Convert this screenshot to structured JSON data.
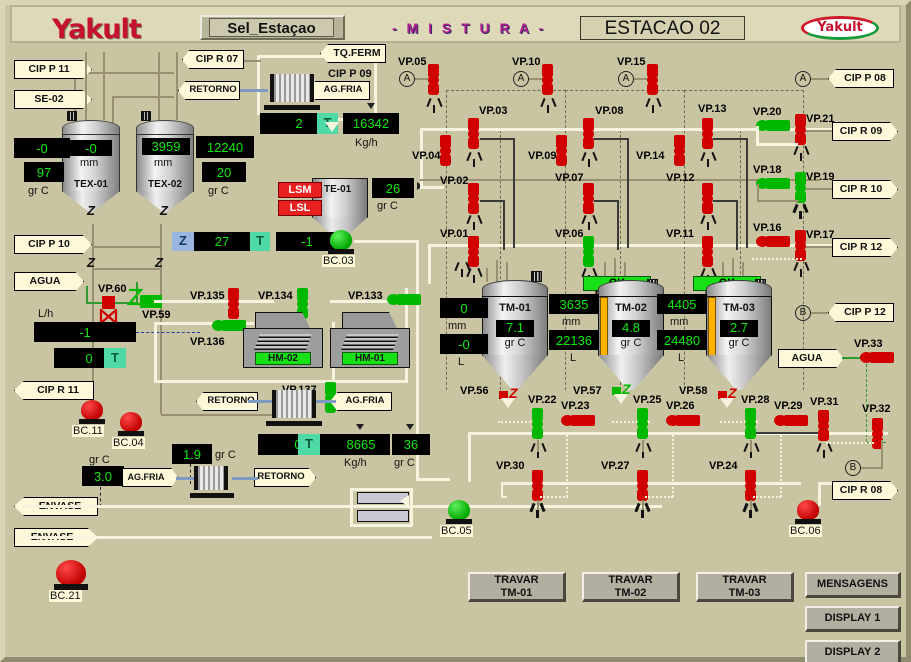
{
  "header": {
    "logo": "Yakult",
    "sel_button": "Sel_Estaçao",
    "mistura": "- M I S T U R A -",
    "station": "ESTACAO 02",
    "brand_badge": "Yakult"
  },
  "left_tags": {
    "cip_p11": "CIP P 11",
    "se02": "SE-02",
    "cip_p10": "CIP P 10",
    "agua": "AGUA",
    "cip_r11": "CIP R 11",
    "envase1": "ENVASE",
    "envase2": "ENVASE"
  },
  "top_tags": {
    "cip_r07": "CIP R 07",
    "tq_ferm": "TQ.FERM",
    "cip_p09": "CIP P 09",
    "retorno_top": "RETORNO",
    "ag_fria_top": "AG.FRIA"
  },
  "right_tags": {
    "cip_p08": "CIP P 08",
    "cip_r09": "CIP R 09",
    "cip_r10": "CIP R 10",
    "cip_r12": "CIP R 12",
    "cip_p12": "CIP P 12",
    "agua_right": "AGUA",
    "cip_r08": "CIP R 08"
  },
  "bottom_tags": {
    "retorno_mid": "RETORNO",
    "ag_fria_mid": "AG.FRIA",
    "ag_fria_low": "AG.FRIA",
    "retorno_low": "RETORNO"
  },
  "tanks": {
    "tex01": {
      "name": "TEX-01",
      "level": "-0",
      "unit": "mm",
      "vol": "-0",
      "temp": "97",
      "temp_unit": "gr C"
    },
    "tex02": {
      "name": "TEX-02",
      "level": "3959",
      "unit": "mm",
      "vol": "12240",
      "temp": "20",
      "temp_unit": "gr C"
    },
    "te01": {
      "name": "TE-01",
      "temp": "26",
      "temp_unit": "gr C",
      "alarm_hi": "LSM",
      "alarm_lo": "LSL"
    },
    "tm01": {
      "name": "TM-01",
      "level": "0",
      "unit": "mm",
      "volume": "-0",
      "vol_unit": "L",
      "temp": "7.1",
      "temp_unit": "gr C",
      "status": "",
      "level_pct": 0
    },
    "tm02": {
      "name": "TM-02",
      "level": "3635",
      "unit": "mm",
      "volume": "22136",
      "vol_unit": "L",
      "temp": "4.8",
      "temp_unit": "gr C",
      "status": "OK ENVASE",
      "level_pct": 100
    },
    "tm03": {
      "name": "TM-03",
      "level": "4405",
      "unit": "mm",
      "volume": "24480",
      "vol_unit": "L",
      "temp": "2.7",
      "temp_unit": "gr C",
      "status": "OK ENVASE",
      "level_pct": 100
    },
    "hm01": {
      "name": "HM-01"
    },
    "hm02": {
      "name": "HM-02"
    }
  },
  "displays": {
    "hx_top_value": "2",
    "hx_top_mode": "T",
    "flow_top": "16342",
    "flow_top_unit": "Kg/h",
    "z_mode": "Z",
    "z_value": "27",
    "z_t": "T",
    "misc_minus1": "-1",
    "flow_lh_label": "L/h",
    "flow_lh_value": "-1",
    "flow_lh2_value": "0",
    "flow_lh2_mode": "T",
    "hx_bot_value": "0",
    "hx_bot_mode": "T",
    "flow_bot": "8665",
    "flow_bot_unit": "Kg/h",
    "temp_bot": "36",
    "temp_bot_unit": "gr C",
    "temp_19": "1.9",
    "temp_19_unit": "gr C",
    "temp_30": "3.0",
    "temp_30_unit": "gr C",
    "grc_label": "gr C"
  },
  "pumps": [
    {
      "name": "BC.03",
      "state": "running"
    },
    {
      "name": "BC.11",
      "state": "stopped"
    },
    {
      "name": "BC.04",
      "state": "stopped"
    },
    {
      "name": "BC.21",
      "state": "stopped"
    },
    {
      "name": "BC.05",
      "state": "running"
    },
    {
      "name": "BC.06",
      "state": "stopped"
    }
  ],
  "valves": [
    {
      "id": "VP.01",
      "state": "closed"
    },
    {
      "id": "VP.02",
      "state": "closed"
    },
    {
      "id": "VP.03",
      "state": "closed"
    },
    {
      "id": "VP.04",
      "state": "closed"
    },
    {
      "id": "VP.05",
      "state": "closed"
    },
    {
      "id": "VP.06",
      "state": "open"
    },
    {
      "id": "VP.07",
      "state": "closed"
    },
    {
      "id": "VP.08",
      "state": "closed"
    },
    {
      "id": "VP.09",
      "state": "closed"
    },
    {
      "id": "VP.10",
      "state": "closed"
    },
    {
      "id": "VP.11",
      "state": "closed"
    },
    {
      "id": "VP.12",
      "state": "closed"
    },
    {
      "id": "VP.13",
      "state": "closed"
    },
    {
      "id": "VP.14",
      "state": "closed"
    },
    {
      "id": "VP.15",
      "state": "closed"
    },
    {
      "id": "VP.16",
      "state": "closed"
    },
    {
      "id": "VP.17",
      "state": "closed"
    },
    {
      "id": "VP.18",
      "state": "open"
    },
    {
      "id": "VP.19",
      "state": "open"
    },
    {
      "id": "VP.20",
      "state": "open"
    },
    {
      "id": "VP.21",
      "state": "closed"
    },
    {
      "id": "VP.22",
      "state": "open"
    },
    {
      "id": "VP.23",
      "state": "closed"
    },
    {
      "id": "VP.24",
      "state": "closed"
    },
    {
      "id": "VP.25",
      "state": "open"
    },
    {
      "id": "VP.26",
      "state": "closed"
    },
    {
      "id": "VP.27",
      "state": "closed"
    },
    {
      "id": "VP.28",
      "state": "open"
    },
    {
      "id": "VP.29",
      "state": "closed"
    },
    {
      "id": "VP.30",
      "state": "closed"
    },
    {
      "id": "VP.31",
      "state": "closed"
    },
    {
      "id": "VP.32",
      "state": "closed"
    },
    {
      "id": "VP.33",
      "state": "closed"
    },
    {
      "id": "VP.56",
      "state": "closed"
    },
    {
      "id": "VP.57",
      "state": "open"
    },
    {
      "id": "VP.58",
      "state": "closed"
    },
    {
      "id": "VP.59",
      "state": "open"
    },
    {
      "id": "VP.60",
      "state": "closed"
    },
    {
      "id": "VP.133",
      "state": "open"
    },
    {
      "id": "VP.134",
      "state": "open"
    },
    {
      "id": "VP.135",
      "state": "closed"
    },
    {
      "id": "VP.136",
      "state": "open"
    },
    {
      "id": "VP.137",
      "state": "open"
    }
  ],
  "markers": {
    "a1": "A",
    "a2": "A",
    "a3": "A",
    "a4": "A",
    "b1": "B",
    "b2": "B"
  },
  "buttons": {
    "travar_tm01": "TRAVAR\nTM-01",
    "travar_tm01_l1": "TRAVAR",
    "travar_tm01_l2": "TM-01",
    "travar_tm02_l1": "TRAVAR",
    "travar_tm02_l2": "TM-02",
    "travar_tm03_l1": "TRAVAR",
    "travar_tm03_l2": "TM-03",
    "mensagens": "MENSAGENS",
    "display1": "DISPLAY 1",
    "display2": "DISPLAY 2"
  },
  "colors": {
    "background": "#c9c5a3",
    "valve_closed": "#d10000",
    "valve_open": "#00b800",
    "display_text": "#12e812",
    "pipe": "#9b8f72",
    "pipe_white": "#f6f3de",
    "alarm": "#e82020",
    "ok_status": "#17e017"
  }
}
